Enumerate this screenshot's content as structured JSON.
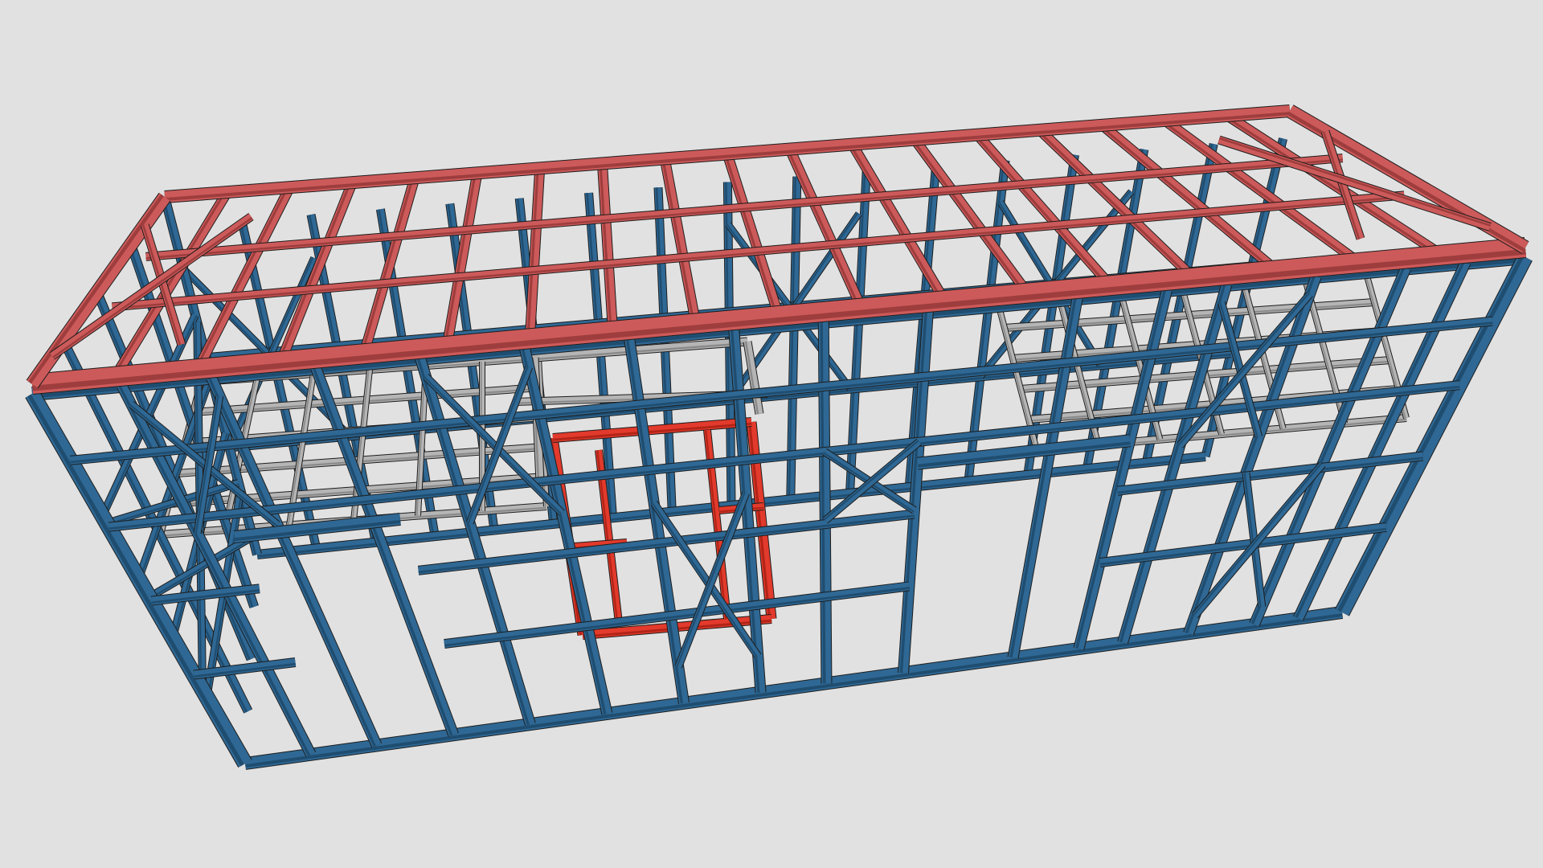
{
  "scene": {
    "background": "#e1e1e1",
    "colors": {
      "wall_frame": "#2f6894",
      "wall_frame_shade": "#1f4d70",
      "roof_frame": "#cd5a5a",
      "roof_frame_shade": "#9e3d3d",
      "inner_frame": "#e23a2c",
      "joist_frame": "#b5b5b5",
      "edge": "#1d1d1d"
    },
    "groups": [
      "wall-frame",
      "roof-frame",
      "inner-frame",
      "floor-joists"
    ]
  }
}
